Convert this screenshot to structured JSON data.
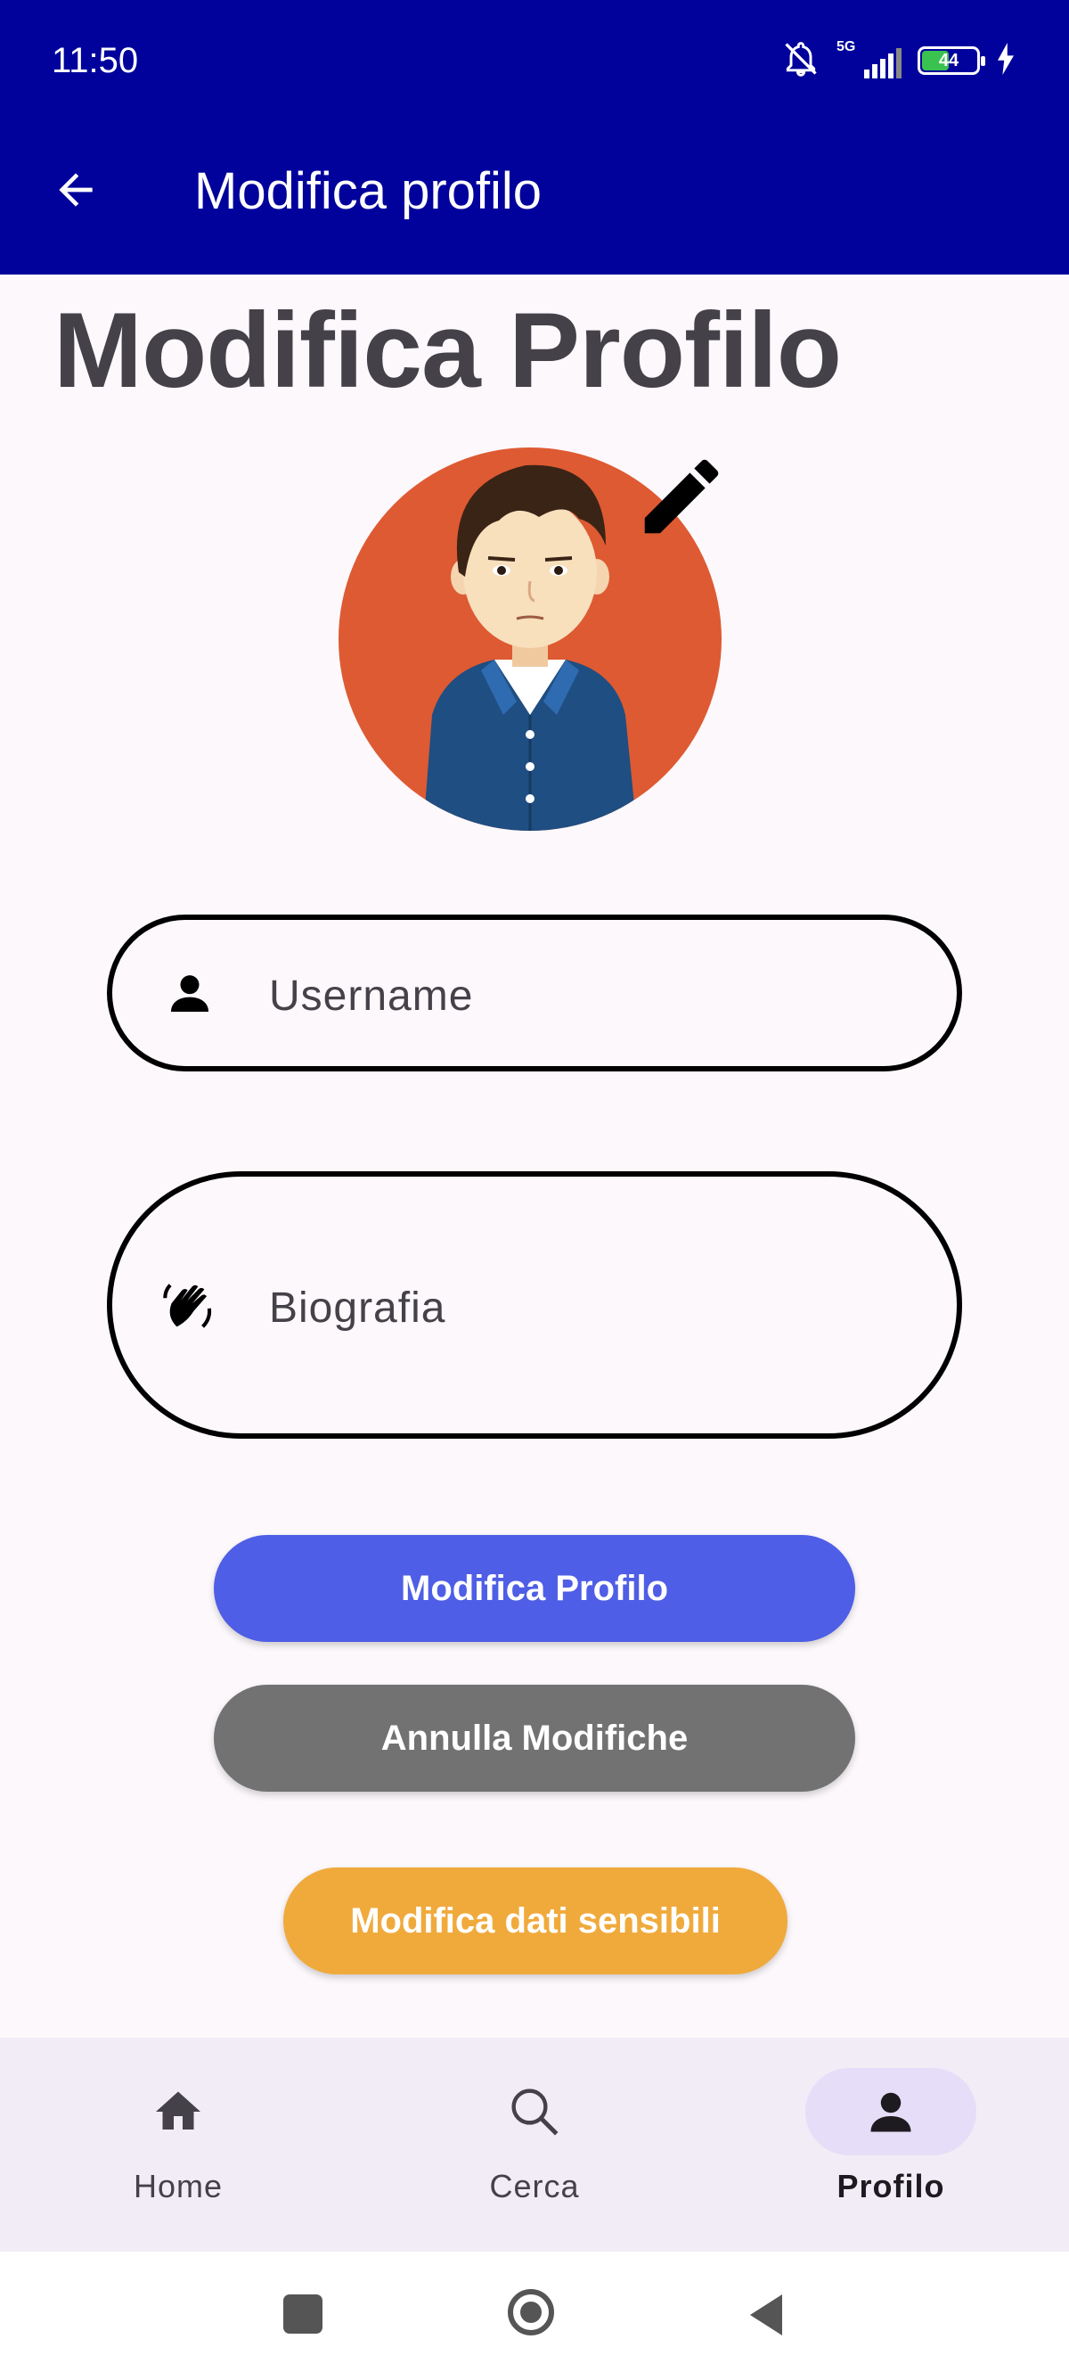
{
  "status": {
    "time": "11:50",
    "network": "5G",
    "battery": "44",
    "icons": [
      "bell-off-icon",
      "signal-icon",
      "battery-icon",
      "charging-icon"
    ]
  },
  "appbar": {
    "title": "Modifica profilo",
    "back_icon": "arrow-left-icon"
  },
  "main": {
    "heading": "Modifica Profilo",
    "avatar_icon": "avatar-illustration",
    "edit_icon": "pencil-icon",
    "username_placeholder": "Username",
    "bio_placeholder": "Biografia",
    "buttons": {
      "save": "Modifica Profilo",
      "cancel": "Annulla Modifiche",
      "sensitive": "Modifica dati sensibili"
    }
  },
  "nav": {
    "items": [
      {
        "label": "Home",
        "icon": "home-icon",
        "active": false
      },
      {
        "label": "Cerca",
        "icon": "search-icon",
        "active": false
      },
      {
        "label": "Profilo",
        "icon": "person-icon",
        "active": true
      }
    ]
  },
  "colors": {
    "appbar": "#01019c",
    "primary_button": "#4f5ee6",
    "cancel_button": "#727272",
    "sensitive_button": "#f0aa3c",
    "avatar_bg": "#de5a32"
  }
}
